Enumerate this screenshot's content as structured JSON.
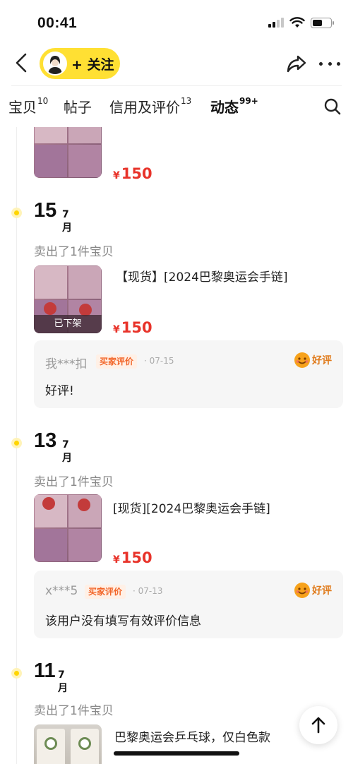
{
  "status_bar": {
    "time": "00:41"
  },
  "header": {
    "follow_label": "+ 关注"
  },
  "tabs": [
    {
      "label": "宝贝",
      "count": "10"
    },
    {
      "label": "帖子",
      "count": ""
    },
    {
      "label": "信用及评价",
      "count": "13"
    },
    {
      "label": "动态",
      "count": "99+"
    }
  ],
  "feed": {
    "top_item": {
      "price": "150",
      "currency": "¥"
    },
    "entries": [
      {
        "day": "15",
        "month": "7月",
        "sold_label": "卖出了1件宝贝",
        "item_title": "【现货】[2024巴黎奥运会手链]",
        "item_status": "已下架",
        "price": "150",
        "currency": "¥",
        "review": {
          "user": "我***扣",
          "badge": "买家评价",
          "date": "· 07-15",
          "rating": "好评",
          "text": "好评!"
        }
      },
      {
        "day": "13",
        "month": "7月",
        "sold_label": "卖出了1件宝贝",
        "item_title": "[现货][2024巴黎奥运会手链]",
        "price": "150",
        "currency": "¥",
        "review": {
          "user": "x***5",
          "badge": "买家评价",
          "date": "· 07-13",
          "rating": "好评",
          "text": "该用户没有填写有效评价信息"
        }
      },
      {
        "day": "11",
        "month": "7月",
        "sold_label": "卖出了1件宝贝",
        "item_title": "巴黎奥运会乒乓球，仅白色款"
      }
    ]
  },
  "icons": {
    "back": "chevron-left-icon",
    "share": "share-icon",
    "more": "more-icon",
    "search": "search-icon",
    "scroll_top": "arrow-up-icon",
    "rating": "smile-face-icon"
  },
  "colors": {
    "accent_yellow": "#ffe033",
    "price_red": "#e8332a",
    "badge_orange": "#f2662a"
  }
}
